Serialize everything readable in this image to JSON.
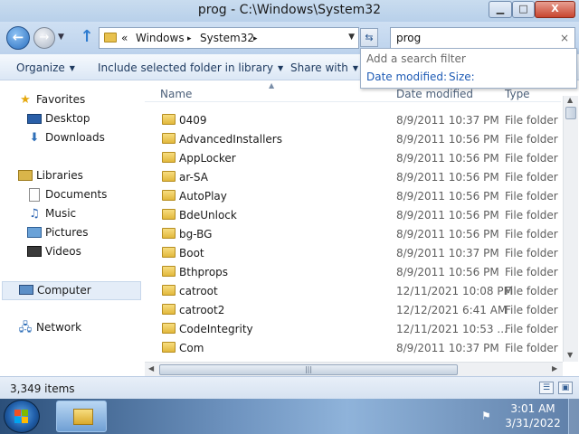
{
  "window": {
    "title": "prog - C:\\Windows\\System32",
    "min_icon": "minimize-icon",
    "max_icon": "maximize-icon",
    "close_icon": "close-icon",
    "min_glyph": "▁",
    "max_glyph": "□",
    "close_glyph": "X"
  },
  "navbar": {
    "back_glyph": "←",
    "forward_glyph": "→",
    "recent_glyph": "▼",
    "up_glyph": "↑",
    "address_prefix": "«",
    "address_segments": [
      "Windows",
      "System32"
    ],
    "segment_sep": "▸",
    "address_dropdown": "▼",
    "refresh_glyph": "⇆",
    "search_value": "prog",
    "search_clear": "×"
  },
  "commands": {
    "organize": "Organize",
    "include": "Include selected folder in library",
    "share": "Share with",
    "arrow": "▼"
  },
  "search_suggest": {
    "title": "Add a search filter",
    "filters": [
      "Date modified:",
      "Size:"
    ]
  },
  "nav_pane": {
    "favorites": "Favorites",
    "desktop": "Desktop",
    "downloads": "Downloads",
    "libraries": "Libraries",
    "documents": "Documents",
    "music": "Music",
    "pictures": "Pictures",
    "videos": "Videos",
    "computer": "Computer",
    "network": "Network",
    "star_glyph": "★",
    "download_glyph": "⬇",
    "music_glyph": "♫",
    "network_glyph": "🖧"
  },
  "file_list": {
    "columns": {
      "name": "Name",
      "date": "Date modified",
      "type": "Type"
    },
    "sort_caret": "▲",
    "rows": [
      {
        "name": "0409",
        "date": "8/9/2011 10:37 PM",
        "type": "File folder"
      },
      {
        "name": "AdvancedInstallers",
        "date": "8/9/2011 10:56 PM",
        "type": "File folder"
      },
      {
        "name": "AppLocker",
        "date": "8/9/2011 10:56 PM",
        "type": "File folder"
      },
      {
        "name": "ar-SA",
        "date": "8/9/2011 10:56 PM",
        "type": "File folder"
      },
      {
        "name": "AutoPlay",
        "date": "8/9/2011 10:56 PM",
        "type": "File folder"
      },
      {
        "name": "BdeUnlock",
        "date": "8/9/2011 10:56 PM",
        "type": "File folder"
      },
      {
        "name": "bg-BG",
        "date": "8/9/2011 10:56 PM",
        "type": "File folder"
      },
      {
        "name": "Boot",
        "date": "8/9/2011 10:37 PM",
        "type": "File folder"
      },
      {
        "name": "Bthprops",
        "date": "8/9/2011 10:56 PM",
        "type": "File folder"
      },
      {
        "name": "catroot",
        "date": "12/11/2021 10:08 PM",
        "type": "File folder"
      },
      {
        "name": "catroot2",
        "date": "12/12/2021 6:41 AM",
        "type": "File folder"
      },
      {
        "name": "CodeIntegrity",
        "date": "12/11/2021 10:53 ...",
        "type": "File folder"
      },
      {
        "name": "Com",
        "date": "8/9/2011 10:37 PM",
        "type": "File folder"
      }
    ]
  },
  "status": {
    "item_count": "3,349 items"
  },
  "taskbar": {
    "time": "3:01 AM",
    "date": "3/31/2022",
    "flag_glyph": "⚑"
  },
  "scroll": {
    "up": "▲",
    "down": "▼",
    "left": "◀",
    "right": "▶",
    "grip": "|||"
  }
}
